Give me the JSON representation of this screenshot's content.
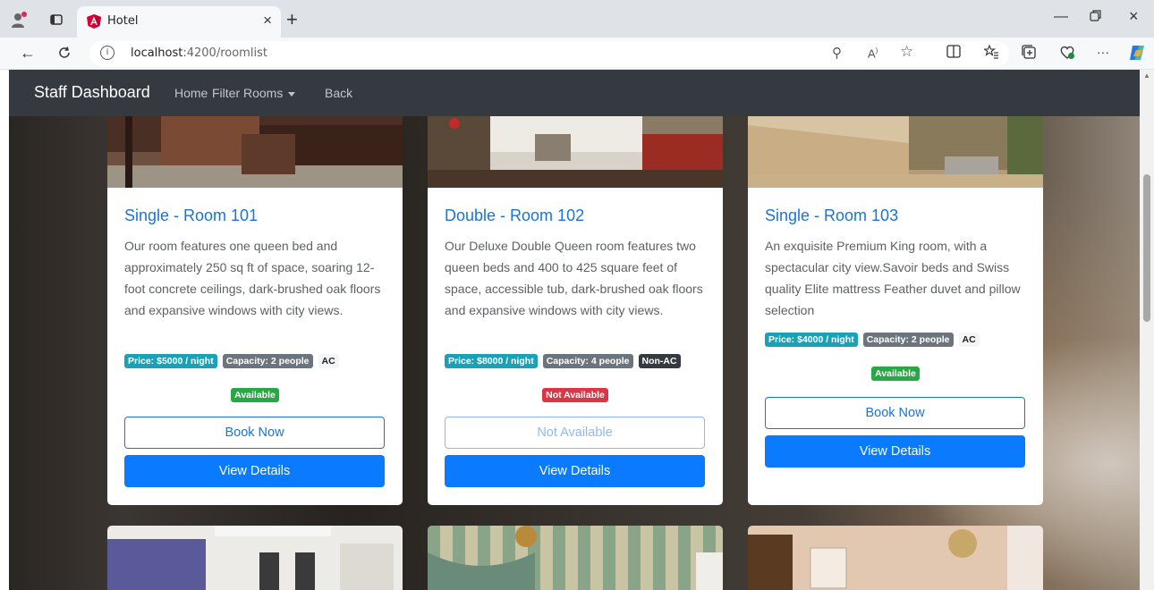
{
  "browser": {
    "tab_title": "Hotel",
    "url_host": "localhost",
    "url_rest": ":4200/roomlist"
  },
  "navbar": {
    "brand": "Staff Dashboard",
    "links": [
      "Home",
      "Filter Rooms",
      "Back"
    ]
  },
  "rooms": [
    {
      "title": "Single - Room 101",
      "description": "Our room features one queen bed and approximately 250 sq ft of space, soaring 12-foot concrete ceilings, dark-brushed oak floors and expansive windows with city views.",
      "price": "Price: $5000 / night",
      "capacity": "Capacity: 2 people",
      "ac": "AC",
      "status": "Available",
      "book_label": "Book Now",
      "details_label": "View Details"
    },
    {
      "title": "Double - Room 102",
      "description": "Our Deluxe Double Queen room features two queen beds and 400 to 425 square feet of space, accessible tub, dark-brushed oak floors and expansive windows with city views.",
      "price": "Price: $8000 / night",
      "capacity": "Capacity: 4 people",
      "ac": "Non-AC",
      "status": "Not Available",
      "book_label": "Not Available",
      "details_label": "View Details"
    },
    {
      "title": "Single - Room 103",
      "description": "An exquisite Premium King room, with a spectacular city view.Savoir beds and Swiss quality Elite mattress Feather duvet and pillow selection",
      "price": "Price: $4000 / night",
      "capacity": "Capacity: 2 people",
      "ac": "AC",
      "status": "Available",
      "book_label": "Book Now",
      "details_label": "View Details"
    }
  ],
  "colors": {
    "navbar": "#343a40",
    "link_blue": "#1a73d9",
    "primary": "#0a7bff",
    "success": "#28a745",
    "danger": "#dc3545",
    "info": "#17a2b8",
    "secondary": "#6c757d"
  }
}
